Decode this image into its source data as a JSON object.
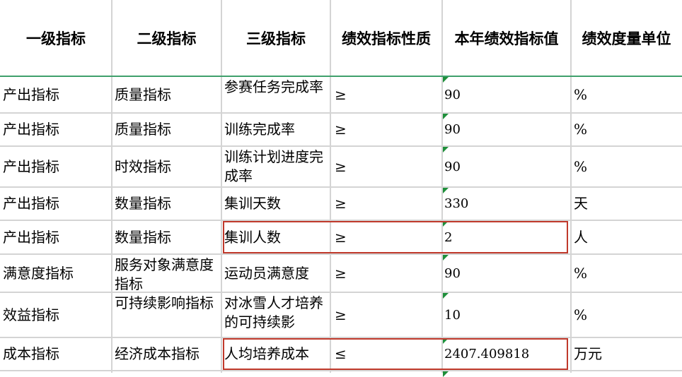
{
  "headers": [
    "一级指标",
    "二级指标",
    "三级指标",
    "绩效指标性质",
    "本年绩效指标值",
    "绩效度量单位"
  ],
  "rows": [
    [
      "产出指标",
      "质量指标",
      "参赛任务完成率",
      "≥",
      "90",
      "%"
    ],
    [
      "产出指标",
      "质量指标",
      "训练完成率",
      "≥",
      "90",
      "%"
    ],
    [
      "产出指标",
      "时效指标",
      "训练计划进度完成率",
      "≥",
      "90",
      "%"
    ],
    [
      "产出指标",
      "数量指标",
      "集训天数",
      "≥",
      "330",
      "天"
    ],
    [
      "产出指标",
      "数量指标",
      "集训人数",
      "≥",
      "2",
      "人"
    ],
    [
      "满意度指标",
      "服务对象满意度指标",
      "运动员满意度",
      "≥",
      "90",
      "%"
    ],
    [
      "效益指标",
      "可持续影响指标",
      "对冰雪人才培养的可持续影",
      "≥",
      "10",
      "%"
    ],
    [
      "成本指标",
      "经济成本指标",
      "人均培养成本",
      "≤",
      "2407.409818",
      "万元"
    ]
  ],
  "highlighted_rows": [
    4,
    7
  ],
  "colors": {
    "grid": "#d4d4d4",
    "header_separator": "#3ea06b",
    "highlight": "#c0392b",
    "cell_marker": "#1e8f3a"
  }
}
